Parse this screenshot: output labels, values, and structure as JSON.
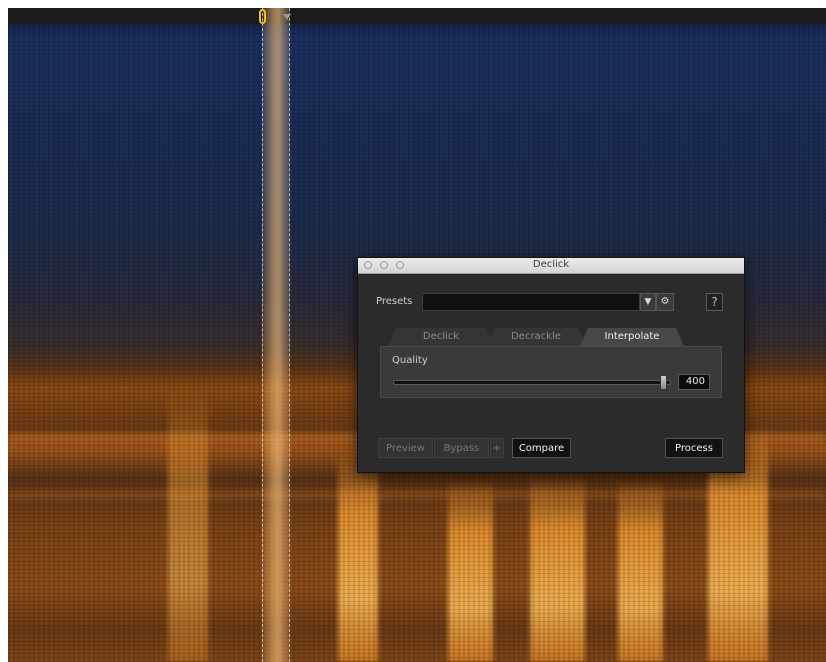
{
  "dialog": {
    "title": "Declick",
    "presets_label": "Presets",
    "presets_value": "",
    "presets_dropdown_glyph": "▼",
    "presets_settings_glyph": "⚙",
    "help_label": "?",
    "tabs": [
      {
        "label": "Declick",
        "active": false
      },
      {
        "label": "Decrackle",
        "active": false
      },
      {
        "label": "Interpolate",
        "active": true
      }
    ],
    "quality_label": "Quality",
    "quality_value": "400",
    "quality_fraction": 0.99,
    "buttons": {
      "preview": "Preview",
      "bypass": "Bypass",
      "plus": "+",
      "compare": "Compare",
      "process": "Process"
    }
  },
  "colors": {
    "playhead": "#e9c21d",
    "spectrogram_low": "#1a2f5e",
    "spectrogram_high": "#ffb347"
  }
}
